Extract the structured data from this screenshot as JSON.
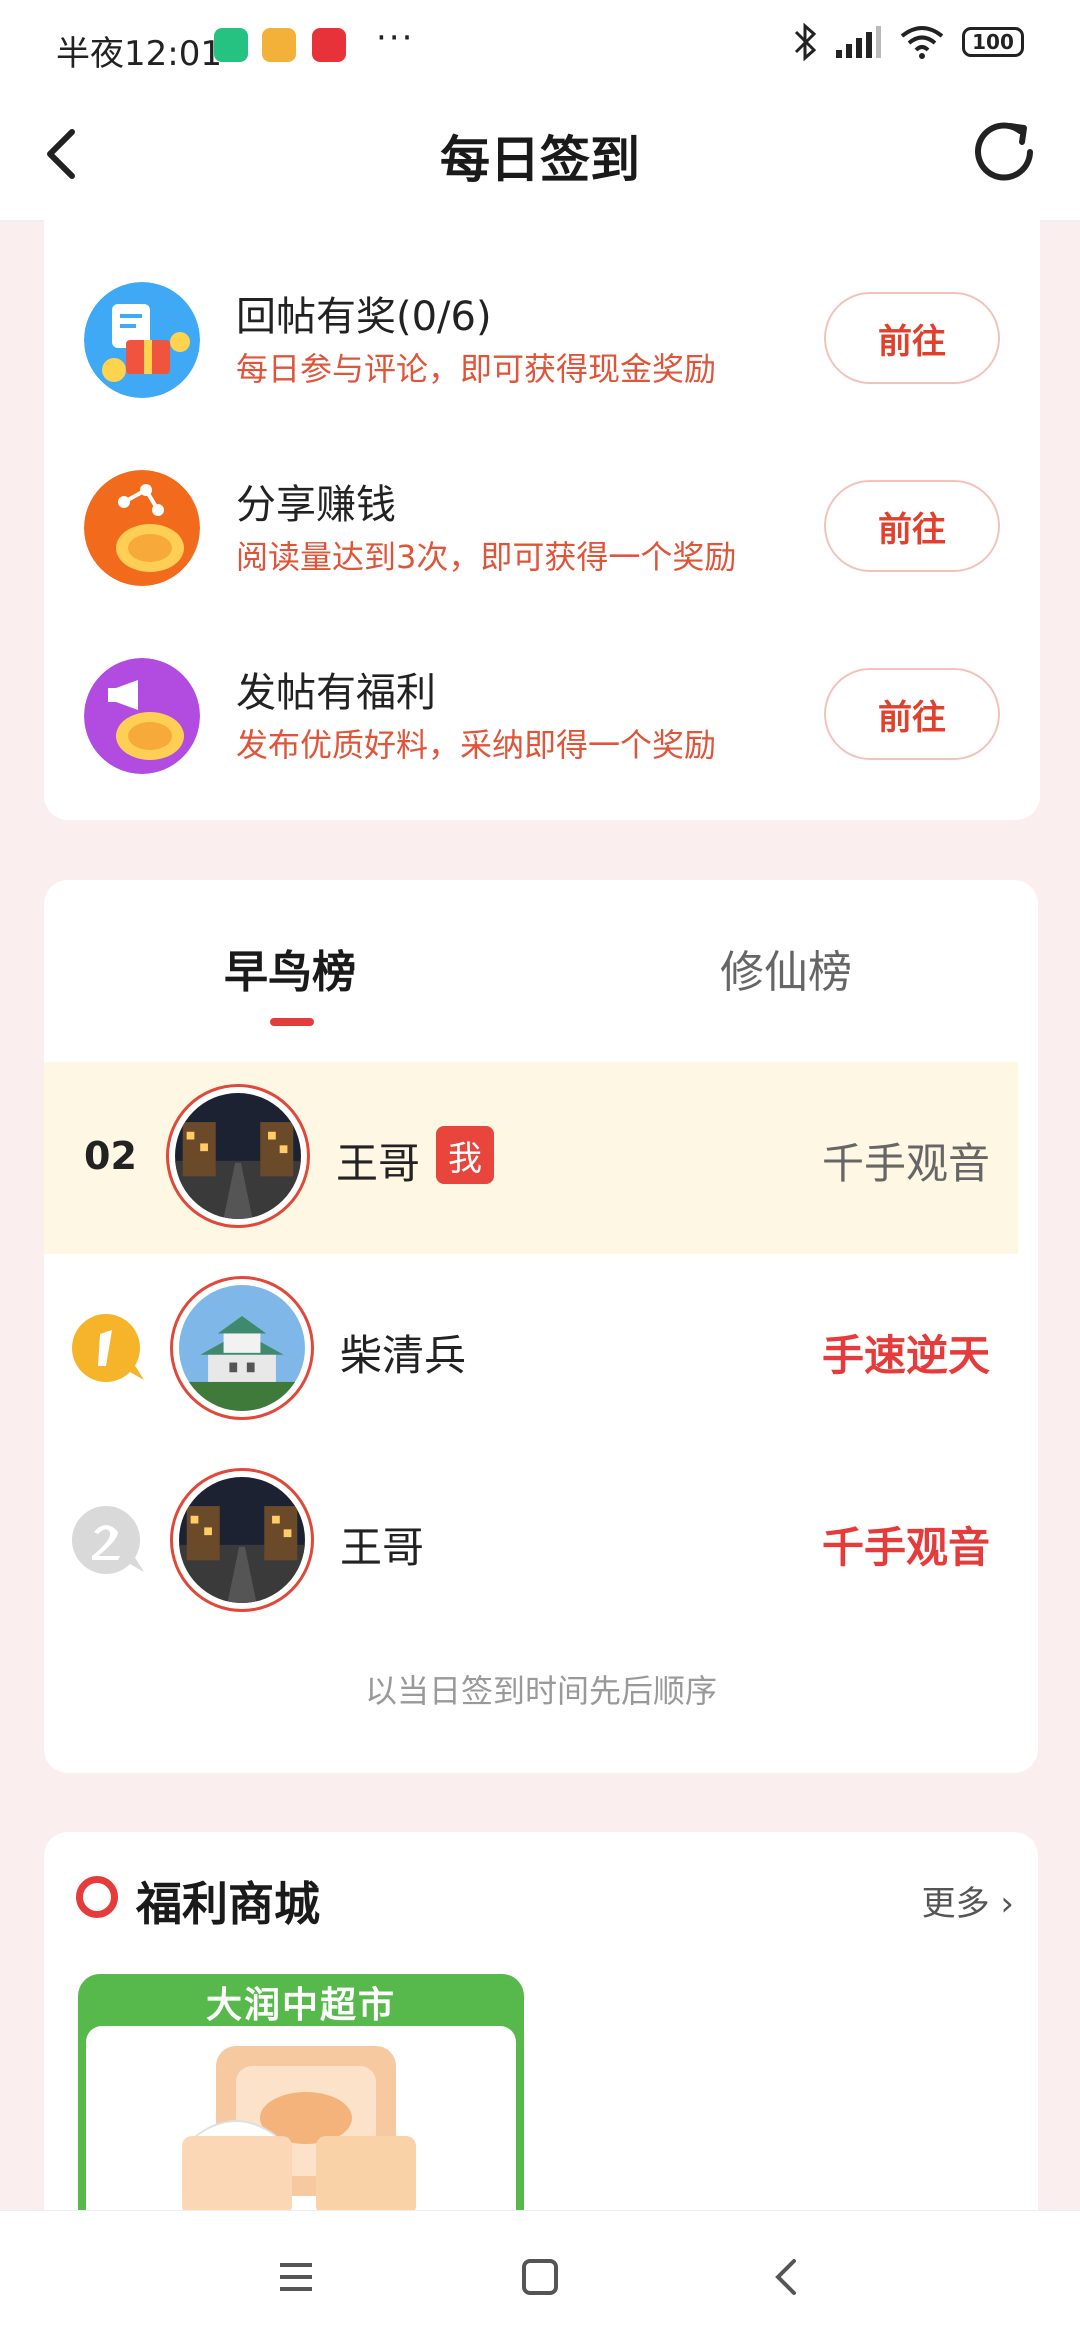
{
  "status_bar": {
    "time": "半夜12:01",
    "battery": "100",
    "more": "···"
  },
  "header": {
    "title": "每日签到"
  },
  "tasks": [
    {
      "title": "回帖有奖(0/6)",
      "desc": "每日参与评论，即可获得现金奖励",
      "button": "前往"
    },
    {
      "title": "分享赚钱",
      "desc": "阅读量达到3次，即可获得一个奖励",
      "button": "前往"
    },
    {
      "title": "发帖有福利",
      "desc": "发布优质好料，采纳即得一个奖励",
      "button": "前往"
    }
  ],
  "ranking": {
    "tabs": [
      "早鸟榜",
      "修仙榜"
    ],
    "me": {
      "rank": "02",
      "name": "王哥",
      "badge": "我",
      "title": "千手观音"
    },
    "rows": [
      {
        "rank": "1",
        "name": "柴清兵",
        "title": "手速逆天"
      },
      {
        "rank": "2",
        "name": "王哥",
        "title": "千手观音"
      }
    ],
    "note": "以当日签到时间先后顺序"
  },
  "mall": {
    "title": "福利商城",
    "more": "更多",
    "product_banner": "大润中超市"
  },
  "colors": {
    "accent": "#e53b3b",
    "page_bg": "#fbeeee",
    "highlight_row": "#fef7e4"
  }
}
